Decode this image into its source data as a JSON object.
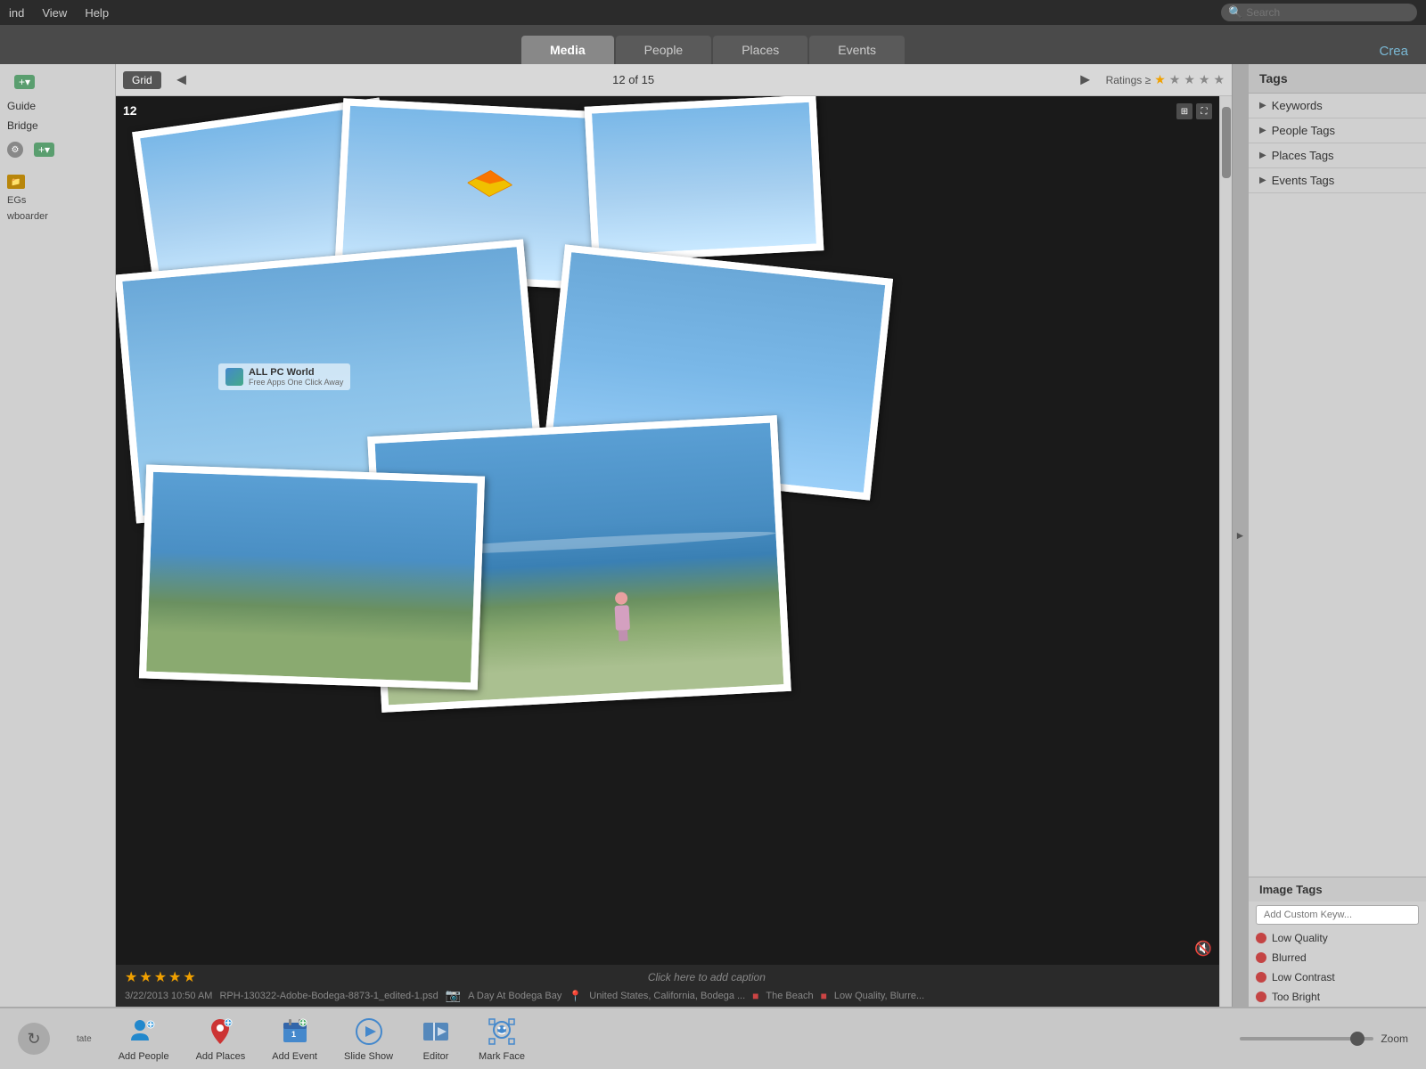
{
  "menubar": {
    "items": [
      "ind",
      "View",
      "Help"
    ],
    "search_placeholder": "Search"
  },
  "tabs": {
    "items": [
      "Media",
      "People",
      "Places",
      "Events"
    ],
    "active": "Media",
    "create_label": "Crea"
  },
  "toolbar": {
    "grid_label": "Grid",
    "page_info": "12 of 15",
    "ratings_label": "Ratings ≥",
    "prev_arrow": "◄",
    "next_arrow": "►"
  },
  "left_panel": {
    "guide_label": "Guide",
    "bridge_label": "Bridge",
    "items_label": "EGs",
    "snowboarder_label": "wboarder"
  },
  "right_panel": {
    "header": "Tags",
    "items": [
      {
        "label": "Keywords"
      },
      {
        "label": "People Tags"
      },
      {
        "label": "Places Tags"
      },
      {
        "label": "Events Tags"
      }
    ]
  },
  "image_tags": {
    "header": "Image Tags",
    "input_placeholder": "Add Custom Keyw...",
    "tags": [
      {
        "label": "Low Quality",
        "color": "#c44444"
      },
      {
        "label": "Blurred",
        "color": "#c44444"
      },
      {
        "label": "Low Contrast",
        "color": "#c44444"
      },
      {
        "label": "Too Bright",
        "color": "#c44444"
      }
    ]
  },
  "image": {
    "number": "12",
    "caption": "Click here to add caption",
    "date": "3/22/2013 10:50 AM",
    "filename": "RPH-130322-Adobe-Bodega-8873-1_edited-1.psd",
    "album": "A Day At Bodega Bay",
    "location": "United States, California, Bodega ...",
    "tag1": "The Beach",
    "tag2": "Low Quality, Blurre...",
    "rating_count": 5
  },
  "watermark": {
    "line1": "ALL PC World",
    "line2": "Free Apps One Click Away"
  },
  "bottom_toolbar": {
    "rotate_label": "tate",
    "add_people_label": "Add People",
    "add_places_label": "Add Places",
    "add_event_label": "Add Event",
    "slideshow_label": "Slide Show",
    "editor_label": "Editor",
    "mark_face_label": "Mark Face",
    "zoom_label": "Zoom"
  }
}
